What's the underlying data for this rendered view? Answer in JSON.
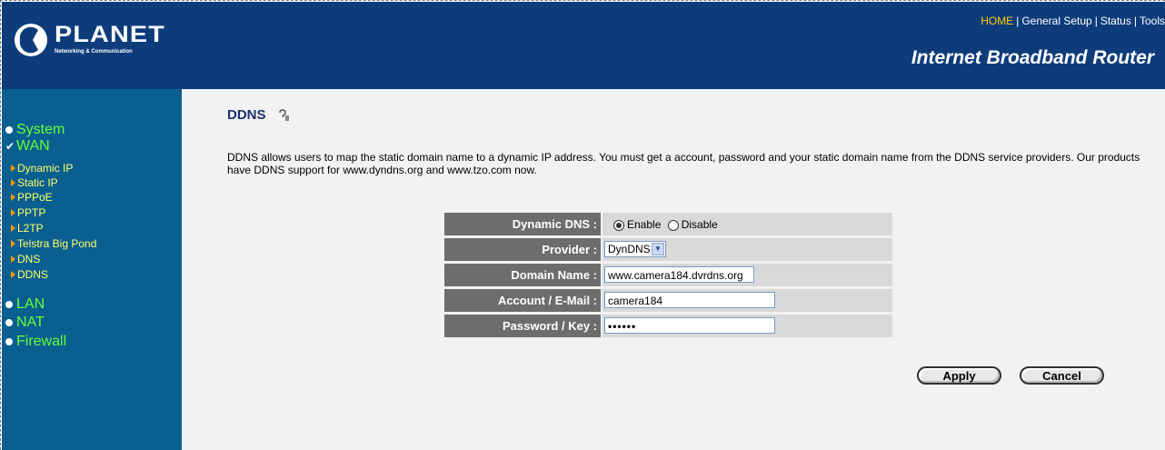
{
  "header": {
    "logo_text": "PLANET",
    "logo_tagline": "Networking & Communication",
    "nav": [
      "HOME",
      "General Setup",
      "Status",
      "Tools"
    ],
    "product_title": "Internet Broadband Router"
  },
  "sidebar": {
    "items": [
      {
        "label": "System",
        "marker": "bullet"
      },
      {
        "label": "WAN",
        "marker": "check"
      },
      {
        "label": "LAN",
        "marker": "bullet"
      },
      {
        "label": "NAT",
        "marker": "bullet"
      },
      {
        "label": "Firewall",
        "marker": "bullet"
      }
    ],
    "wan_sub": [
      "Dynamic IP",
      "Static IP",
      "PPPoE",
      "PPTP",
      "L2TP",
      "Telstra Big Pond",
      "DNS",
      "DDNS"
    ]
  },
  "page": {
    "title": "DDNS",
    "description": "DDNS allows users to map the static domain name to a dynamic IP address. You must get a account, password and your static domain name from the DDNS service providers. Our products have DDNS support for www.dyndns.org and www.tzo.com now."
  },
  "form": {
    "dynamic_dns_label": "Dynamic DNS :",
    "enable_label": "Enable",
    "disable_label": "Disable",
    "dynamic_dns_value": "Enable",
    "provider_label": "Provider :",
    "provider_value": "DynDNS",
    "domain_label": "Domain Name :",
    "domain_value": "www.camera184.dvrdns.org",
    "account_label": "Account / E-Mail :",
    "account_value": "camera184",
    "password_label": "Password / Key :",
    "password_value": "••••••"
  },
  "buttons": {
    "apply": "Apply",
    "cancel": "Cancel"
  },
  "colors": {
    "header_bg": "#0e3c7b",
    "sidebar_bg": "#0a5f91",
    "menu_top": "#66ff33",
    "menu_sub": "#ffff66",
    "home_link": "#ffcc00",
    "label_bg": "#6d6d6d"
  }
}
